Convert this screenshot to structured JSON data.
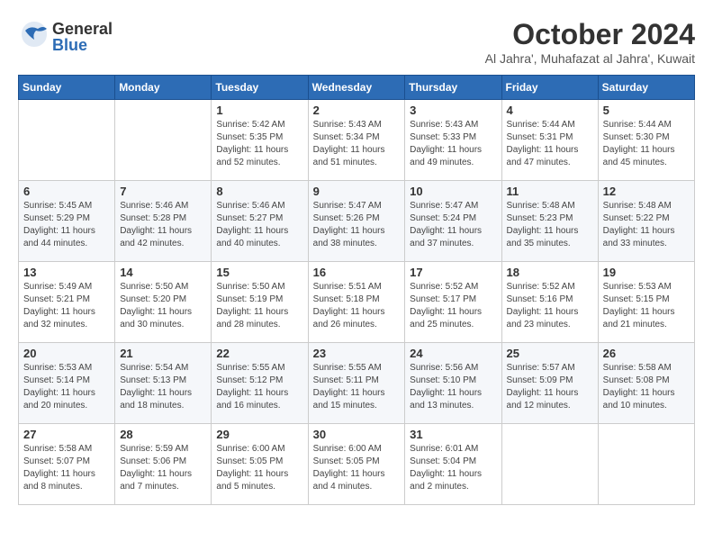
{
  "header": {
    "logo_general": "General",
    "logo_blue": "Blue",
    "month_title": "October 2024",
    "subtitle": "Al Jahra', Muhafazat al Jahra', Kuwait"
  },
  "days_of_week": [
    "Sunday",
    "Monday",
    "Tuesday",
    "Wednesday",
    "Thursday",
    "Friday",
    "Saturday"
  ],
  "weeks": [
    [
      {
        "day": "",
        "info": ""
      },
      {
        "day": "",
        "info": ""
      },
      {
        "day": "1",
        "info": "Sunrise: 5:42 AM\nSunset: 5:35 PM\nDaylight: 11 hours and 52 minutes."
      },
      {
        "day": "2",
        "info": "Sunrise: 5:43 AM\nSunset: 5:34 PM\nDaylight: 11 hours and 51 minutes."
      },
      {
        "day": "3",
        "info": "Sunrise: 5:43 AM\nSunset: 5:33 PM\nDaylight: 11 hours and 49 minutes."
      },
      {
        "day": "4",
        "info": "Sunrise: 5:44 AM\nSunset: 5:31 PM\nDaylight: 11 hours and 47 minutes."
      },
      {
        "day": "5",
        "info": "Sunrise: 5:44 AM\nSunset: 5:30 PM\nDaylight: 11 hours and 45 minutes."
      }
    ],
    [
      {
        "day": "6",
        "info": "Sunrise: 5:45 AM\nSunset: 5:29 PM\nDaylight: 11 hours and 44 minutes."
      },
      {
        "day": "7",
        "info": "Sunrise: 5:46 AM\nSunset: 5:28 PM\nDaylight: 11 hours and 42 minutes."
      },
      {
        "day": "8",
        "info": "Sunrise: 5:46 AM\nSunset: 5:27 PM\nDaylight: 11 hours and 40 minutes."
      },
      {
        "day": "9",
        "info": "Sunrise: 5:47 AM\nSunset: 5:26 PM\nDaylight: 11 hours and 38 minutes."
      },
      {
        "day": "10",
        "info": "Sunrise: 5:47 AM\nSunset: 5:24 PM\nDaylight: 11 hours and 37 minutes."
      },
      {
        "day": "11",
        "info": "Sunrise: 5:48 AM\nSunset: 5:23 PM\nDaylight: 11 hours and 35 minutes."
      },
      {
        "day": "12",
        "info": "Sunrise: 5:48 AM\nSunset: 5:22 PM\nDaylight: 11 hours and 33 minutes."
      }
    ],
    [
      {
        "day": "13",
        "info": "Sunrise: 5:49 AM\nSunset: 5:21 PM\nDaylight: 11 hours and 32 minutes."
      },
      {
        "day": "14",
        "info": "Sunrise: 5:50 AM\nSunset: 5:20 PM\nDaylight: 11 hours and 30 minutes."
      },
      {
        "day": "15",
        "info": "Sunrise: 5:50 AM\nSunset: 5:19 PM\nDaylight: 11 hours and 28 minutes."
      },
      {
        "day": "16",
        "info": "Sunrise: 5:51 AM\nSunset: 5:18 PM\nDaylight: 11 hours and 26 minutes."
      },
      {
        "day": "17",
        "info": "Sunrise: 5:52 AM\nSunset: 5:17 PM\nDaylight: 11 hours and 25 minutes."
      },
      {
        "day": "18",
        "info": "Sunrise: 5:52 AM\nSunset: 5:16 PM\nDaylight: 11 hours and 23 minutes."
      },
      {
        "day": "19",
        "info": "Sunrise: 5:53 AM\nSunset: 5:15 PM\nDaylight: 11 hours and 21 minutes."
      }
    ],
    [
      {
        "day": "20",
        "info": "Sunrise: 5:53 AM\nSunset: 5:14 PM\nDaylight: 11 hours and 20 minutes."
      },
      {
        "day": "21",
        "info": "Sunrise: 5:54 AM\nSunset: 5:13 PM\nDaylight: 11 hours and 18 minutes."
      },
      {
        "day": "22",
        "info": "Sunrise: 5:55 AM\nSunset: 5:12 PM\nDaylight: 11 hours and 16 minutes."
      },
      {
        "day": "23",
        "info": "Sunrise: 5:55 AM\nSunset: 5:11 PM\nDaylight: 11 hours and 15 minutes."
      },
      {
        "day": "24",
        "info": "Sunrise: 5:56 AM\nSunset: 5:10 PM\nDaylight: 11 hours and 13 minutes."
      },
      {
        "day": "25",
        "info": "Sunrise: 5:57 AM\nSunset: 5:09 PM\nDaylight: 11 hours and 12 minutes."
      },
      {
        "day": "26",
        "info": "Sunrise: 5:58 AM\nSunset: 5:08 PM\nDaylight: 11 hours and 10 minutes."
      }
    ],
    [
      {
        "day": "27",
        "info": "Sunrise: 5:58 AM\nSunset: 5:07 PM\nDaylight: 11 hours and 8 minutes."
      },
      {
        "day": "28",
        "info": "Sunrise: 5:59 AM\nSunset: 5:06 PM\nDaylight: 11 hours and 7 minutes."
      },
      {
        "day": "29",
        "info": "Sunrise: 6:00 AM\nSunset: 5:05 PM\nDaylight: 11 hours and 5 minutes."
      },
      {
        "day": "30",
        "info": "Sunrise: 6:00 AM\nSunset: 5:05 PM\nDaylight: 11 hours and 4 minutes."
      },
      {
        "day": "31",
        "info": "Sunrise: 6:01 AM\nSunset: 5:04 PM\nDaylight: 11 hours and 2 minutes."
      },
      {
        "day": "",
        "info": ""
      },
      {
        "day": "",
        "info": ""
      }
    ]
  ]
}
